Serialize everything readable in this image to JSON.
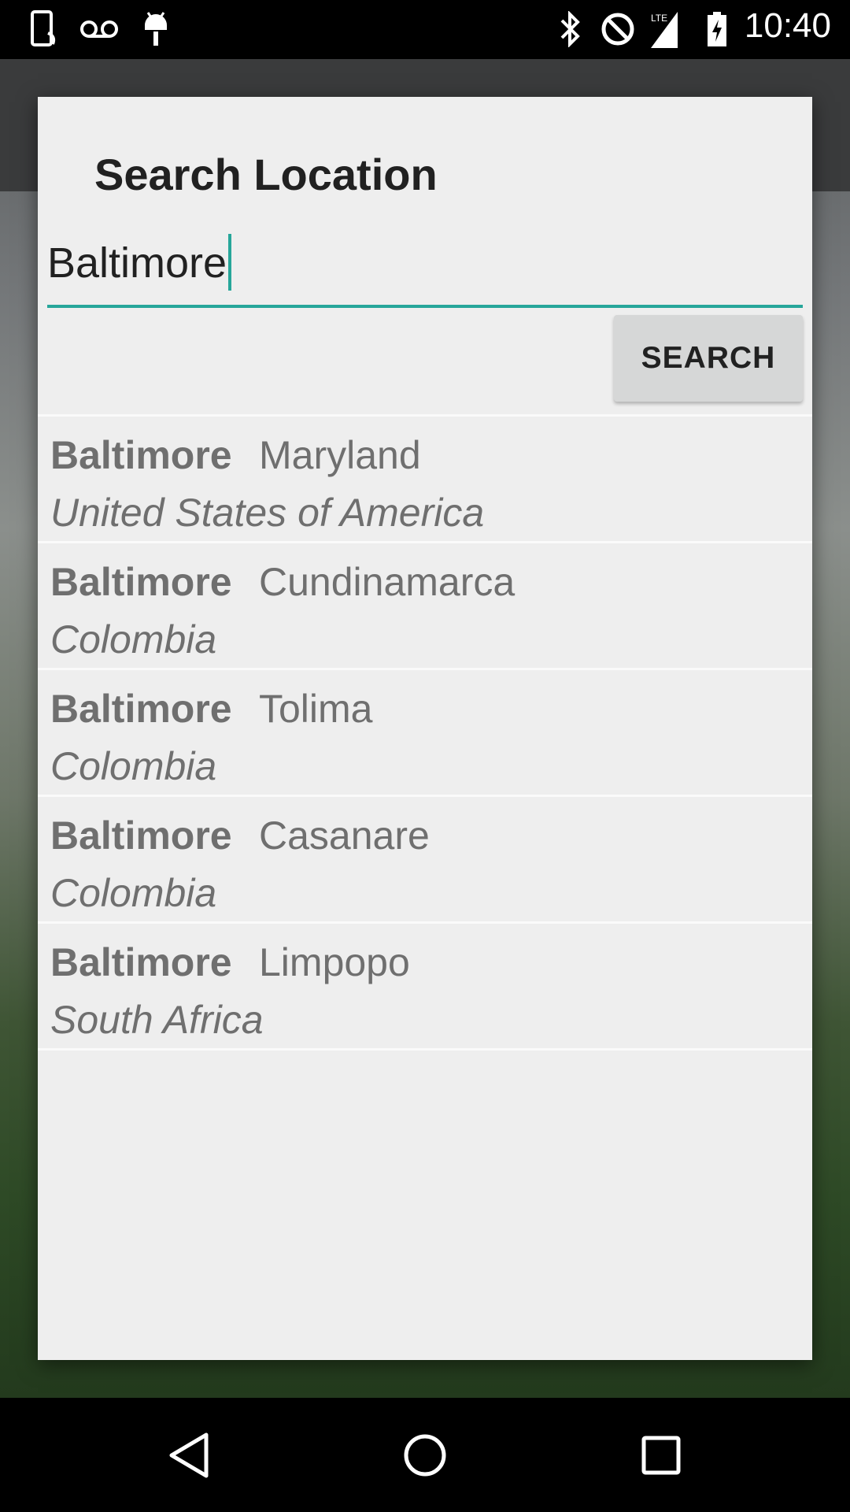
{
  "status_bar": {
    "time": "10:40",
    "left_icons": [
      "phone-sync-icon",
      "voicemail-icon",
      "android-debug-icon"
    ],
    "right_icons": [
      "bluetooth-icon",
      "do-not-disturb-icon",
      "lte-signal-icon",
      "battery-charging-icon"
    ]
  },
  "dialog": {
    "title": "Search Location",
    "search_input_value": "Baltimore",
    "search_button_label": "SEARCH",
    "accent_color": "#26a69a"
  },
  "results": [
    {
      "city": "Baltimore",
      "region": "Maryland",
      "country": "United States of America"
    },
    {
      "city": "Baltimore",
      "region": "Cundinamarca",
      "country": "Colombia"
    },
    {
      "city": "Baltimore",
      "region": "Tolima",
      "country": "Colombia"
    },
    {
      "city": "Baltimore",
      "region": "Casanare",
      "country": "Colombia"
    },
    {
      "city": "Baltimore",
      "region": "Limpopo",
      "country": "South Africa"
    }
  ],
  "nav_bar": {
    "buttons": [
      "back-icon",
      "home-icon",
      "recents-icon"
    ]
  }
}
